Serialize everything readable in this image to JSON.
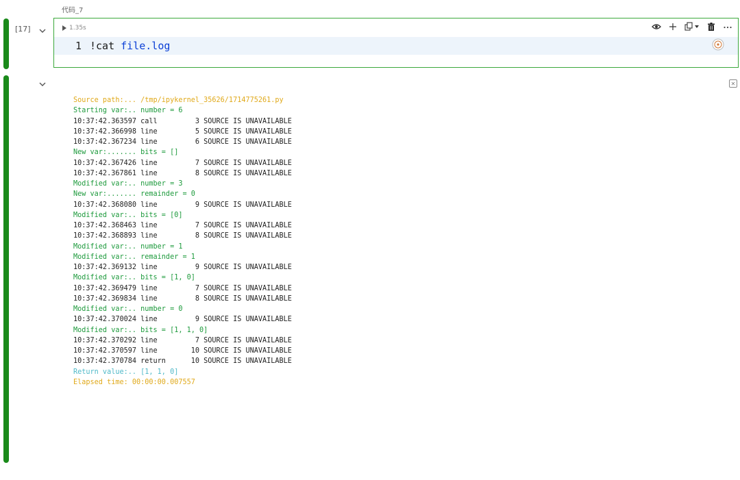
{
  "cell": {
    "name": "代码_7",
    "execution_count": "[17]",
    "run_duration": "1.35s",
    "line_number": "1",
    "code": {
      "bang": "!",
      "cmd": "cat",
      "arg": "file.log"
    }
  },
  "toolbar": {
    "icons": [
      "eye-icon",
      "plus-icon",
      "copy-icon",
      "dropdown-icon",
      "trash-icon",
      "more-icon"
    ]
  },
  "colors": {
    "run_bar": "#1a8a1a",
    "cell_border": "#3aa83a",
    "code_highlight": "#edf4fb",
    "output_orange": "#e0a91a",
    "output_green": "#1d9a3c",
    "output_black": "#222222",
    "output_cyan": "#4fb9c8"
  },
  "output_lines": [
    {
      "text": "Source path:... /tmp/ipykernel_35626/1714775261.py",
      "color": "orange"
    },
    {
      "text": "Starting var:.. number = 6",
      "color": "green"
    },
    {
      "text": "10:37:42.363597 call         3 SOURCE IS UNAVAILABLE",
      "color": "black"
    },
    {
      "text": "10:37:42.366998 line         5 SOURCE IS UNAVAILABLE",
      "color": "black"
    },
    {
      "text": "10:37:42.367234 line         6 SOURCE IS UNAVAILABLE",
      "color": "black"
    },
    {
      "text": "New var:....... bits = []",
      "color": "green"
    },
    {
      "text": "10:37:42.367426 line         7 SOURCE IS UNAVAILABLE",
      "color": "black"
    },
    {
      "text": "10:37:42.367861 line         8 SOURCE IS UNAVAILABLE",
      "color": "black"
    },
    {
      "text": "Modified var:.. number = 3",
      "color": "green"
    },
    {
      "text": "New var:....... remainder = 0",
      "color": "green"
    },
    {
      "text": "10:37:42.368080 line         9 SOURCE IS UNAVAILABLE",
      "color": "black"
    },
    {
      "text": "Modified var:.. bits = [0]",
      "color": "green"
    },
    {
      "text": "10:37:42.368463 line         7 SOURCE IS UNAVAILABLE",
      "color": "black"
    },
    {
      "text": "10:37:42.368893 line         8 SOURCE IS UNAVAILABLE",
      "color": "black"
    },
    {
      "text": "Modified var:.. number = 1",
      "color": "green"
    },
    {
      "text": "Modified var:.. remainder = 1",
      "color": "green"
    },
    {
      "text": "10:37:42.369132 line         9 SOURCE IS UNAVAILABLE",
      "color": "black"
    },
    {
      "text": "Modified var:.. bits = [1, 0]",
      "color": "green"
    },
    {
      "text": "10:37:42.369479 line         7 SOURCE IS UNAVAILABLE",
      "color": "black"
    },
    {
      "text": "10:37:42.369834 line         8 SOURCE IS UNAVAILABLE",
      "color": "black"
    },
    {
      "text": "Modified var:.. number = 0",
      "color": "green"
    },
    {
      "text": "10:37:42.370024 line         9 SOURCE IS UNAVAILABLE",
      "color": "black"
    },
    {
      "text": "Modified var:.. bits = [1, 1, 0]",
      "color": "green"
    },
    {
      "text": "10:37:42.370292 line         7 SOURCE IS UNAVAILABLE",
      "color": "black"
    },
    {
      "text": "10:37:42.370597 line        10 SOURCE IS UNAVAILABLE",
      "color": "black"
    },
    {
      "text": "10:37:42.370784 return      10 SOURCE IS UNAVAILABLE",
      "color": "black"
    },
    {
      "text": "Return value:.. [1, 1, 0]",
      "color": "cyan"
    },
    {
      "text": "Elapsed time: 00:00:00.007557",
      "color": "orange"
    }
  ]
}
